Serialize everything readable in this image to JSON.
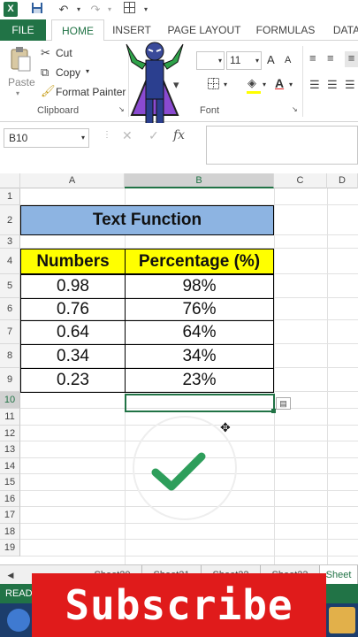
{
  "qat": {
    "logo": "X",
    "save_icon": "save-icon",
    "undo_icon": "undo-icon",
    "redo_icon": "redo-icon",
    "border_icon": "borders-icon"
  },
  "tabs": [
    "FILE",
    "HOME",
    "INSERT",
    "PAGE LAYOUT",
    "FORMULAS",
    "DATA"
  ],
  "ribbon": {
    "paste": "Paste",
    "cut": "Cut",
    "copy": "Copy",
    "format_painter": "Format Painter",
    "clipboard_label": "Clipboard",
    "font_label": "Font",
    "font_size": "11",
    "grow": "A",
    "shrink": "A"
  },
  "formula_bar": {
    "name_box": "B10",
    "fx": "fx",
    "value": ""
  },
  "columns": [
    "A",
    "B",
    "C",
    "D"
  ],
  "rows": [
    "1",
    "2",
    "3",
    "4",
    "5",
    "6",
    "7",
    "8",
    "9",
    "10",
    "11",
    "12",
    "13",
    "14",
    "15",
    "16",
    "17",
    "18",
    "19"
  ],
  "table": {
    "title": "Text Function",
    "headers": [
      "Numbers",
      "Percentage (%)"
    ],
    "data": [
      [
        "0.98",
        "98%"
      ],
      [
        "0.76",
        "76%"
      ],
      [
        "0.64",
        "64%"
      ],
      [
        "0.34",
        "34%"
      ],
      [
        "0.23",
        "23%"
      ]
    ]
  },
  "sheets": [
    "Sheet20",
    "Sheet21",
    "Sheet22",
    "Sheet23",
    "Sheet"
  ],
  "status": "READY",
  "overlay": {
    "subscribe": "Subscribe",
    "check_icon": "check-icon",
    "character": "superhero-character"
  },
  "colors": {
    "excel_green": "#217346",
    "title_fill": "#8db4e2",
    "header_fill": "#ffff00",
    "check_green": "#2e9e5b",
    "subscribe_red": "#e01b1b"
  }
}
